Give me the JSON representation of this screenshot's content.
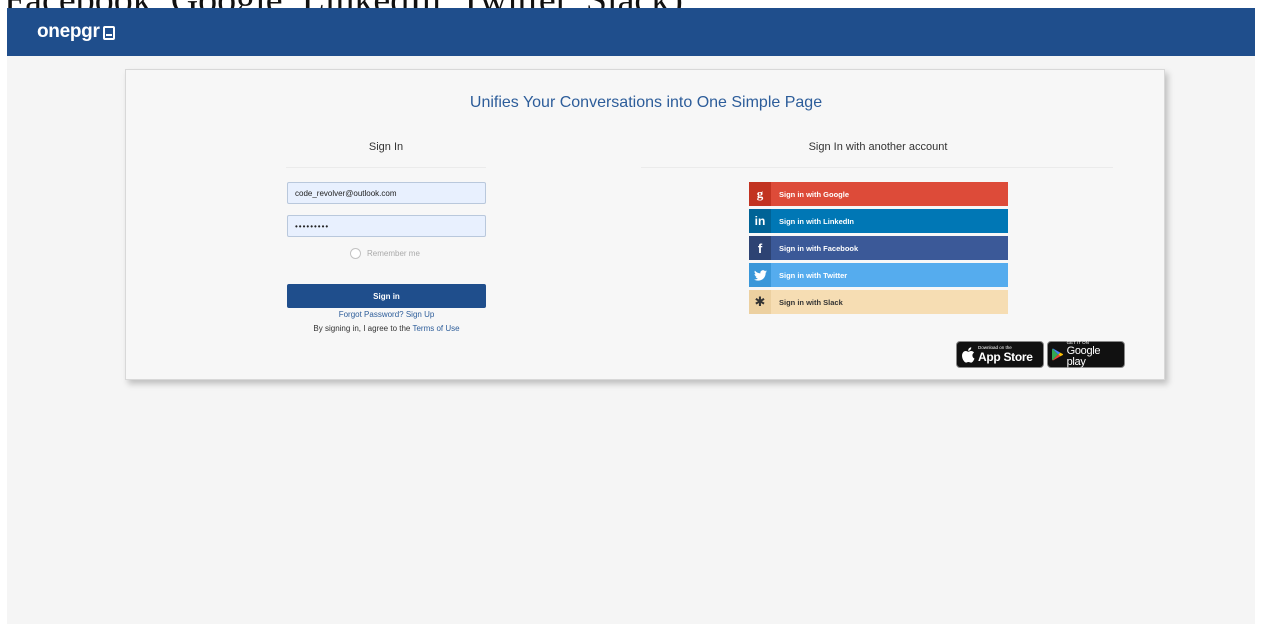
{
  "page_caption": "Facebook, Google, LinkedIn, Twitter, Slack)",
  "brand": {
    "name": "onepgr"
  },
  "headline": "Unifies Your Conversations into One Simple Page",
  "sign_in": {
    "title": "Sign In",
    "email_value": "code_revolver@outlook.com",
    "password_value": "•••••••••",
    "remember_label": "Remember me",
    "button_label": "Sign in",
    "forgot_label": "Forgot Password?",
    "signup_label": "Sign Up",
    "agree_text": "By signing in, I agree to the",
    "terms_label": "Terms of Use"
  },
  "social": {
    "title": "Sign In with another account",
    "buttons": [
      {
        "label": "Sign in with Google",
        "icon": "google-icon",
        "glyph": "g",
        "color": "#dd4b39"
      },
      {
        "label": "Sign in with LinkedIn",
        "icon": "linkedin-icon",
        "glyph": "in",
        "color": "#0077b5"
      },
      {
        "label": "Sign in with Facebook",
        "icon": "facebook-icon",
        "glyph": "f",
        "color": "#3b5998"
      },
      {
        "label": "Sign in with Twitter",
        "icon": "twitter-icon",
        "glyph": "🐦",
        "color": "#55acee"
      },
      {
        "label": "Sign in with Slack",
        "icon": "slack-icon",
        "glyph": "✱",
        "color": "#f6ddb3"
      }
    ]
  },
  "stores": {
    "appstore_small": "Download on the",
    "appstore_big": "App Store",
    "gplay_small": "GET IT ON",
    "gplay_big": "Google play"
  },
  "colors": {
    "navbar": "#1f4e8c",
    "accent": "#2d5d9a",
    "background": "#f5f5f5"
  }
}
